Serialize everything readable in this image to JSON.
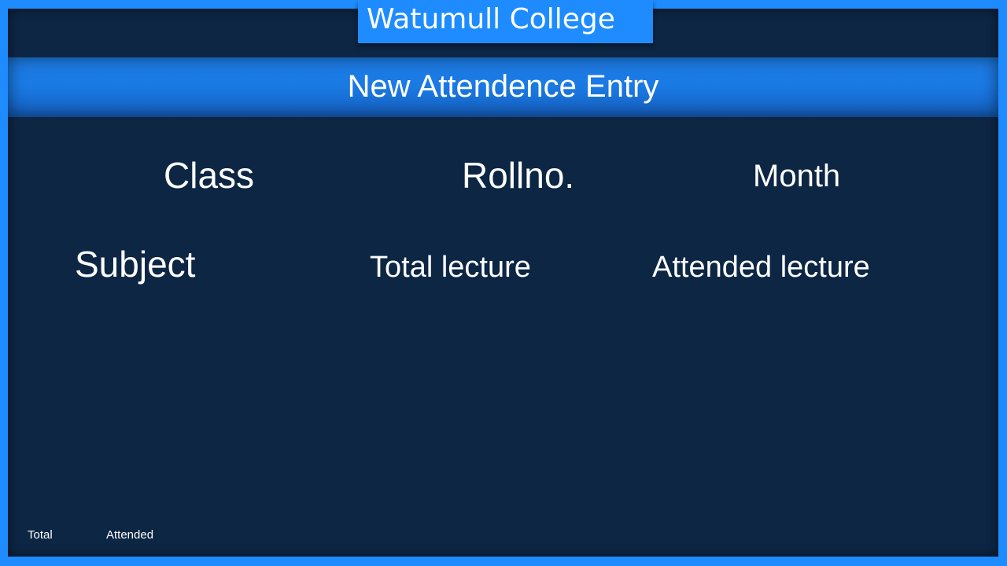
{
  "college": {
    "name": "Watumull College"
  },
  "header": {
    "title": "New Attendence Entry"
  },
  "form": {
    "class_label": "Class",
    "rollno_label": "Rollno.",
    "month_label": "Month",
    "subject_label": "Subject",
    "total_lecture_label": "Total lecture",
    "attended_lecture_label": "Attended lecture"
  },
  "footer": {
    "total_label": "Total",
    "attended_label": "Attended"
  },
  "colors": {
    "border_blue": "#1e8cff",
    "panel_navy": "#0c2644",
    "header_blue": "#1a79e3",
    "text": "#ffffff"
  }
}
